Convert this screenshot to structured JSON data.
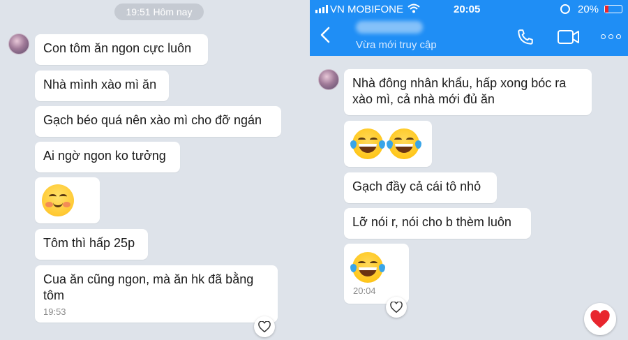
{
  "left": {
    "date_separator": "19:51 Hôm nay",
    "messages": [
      {
        "text": "Con tôm ăn ngon cực luôn"
      },
      {
        "text": "Nhà mình xào mì ăn"
      },
      {
        "text": "Gạch béo quá nên xào mì cho đỡ ngán"
      },
      {
        "text": "Ai ngờ ngon ko tưởng"
      },
      {
        "text": "Tôm thì hấp 25p"
      },
      {
        "text_line1": "Cua ăn cũng ngon, mà ăn hk đã bằng",
        "text_line2": "tôm",
        "time": "19:53"
      }
    ],
    "sticker_icon": "happy-blush-face",
    "reaction_icon": "heart-outline"
  },
  "right": {
    "status_bar": {
      "carrier": "VN MOBIFONE",
      "time": "20:05",
      "battery": "20%",
      "battery_level": 0.2
    },
    "header": {
      "contact_status": "Vừa mới truy cập",
      "back_icon": "chevron-left",
      "call_icon": "phone",
      "video_icon": "video-camera",
      "more_icon": "more-dots"
    },
    "messages": [
      {
        "line1": "Nhà đông nhân khẩu, hấp xong bóc ra",
        "line2": "xào mì, cả nhà mới đủ ăn"
      },
      {
        "text": "Gạch đầy cả cái tô nhỏ"
      },
      {
        "text": "Lỡ nói r, nói cho b thèm luôn"
      },
      {
        "time": "20:04"
      }
    ],
    "emoji_icon": "tears-of-joy-face",
    "reaction_icon": "heart-outline",
    "quick_reaction_icon": "red-heart"
  },
  "colors": {
    "chat_bg": "#dee3ea",
    "header_blue": "#1f8ef5",
    "heart_red": "#e8262e"
  }
}
